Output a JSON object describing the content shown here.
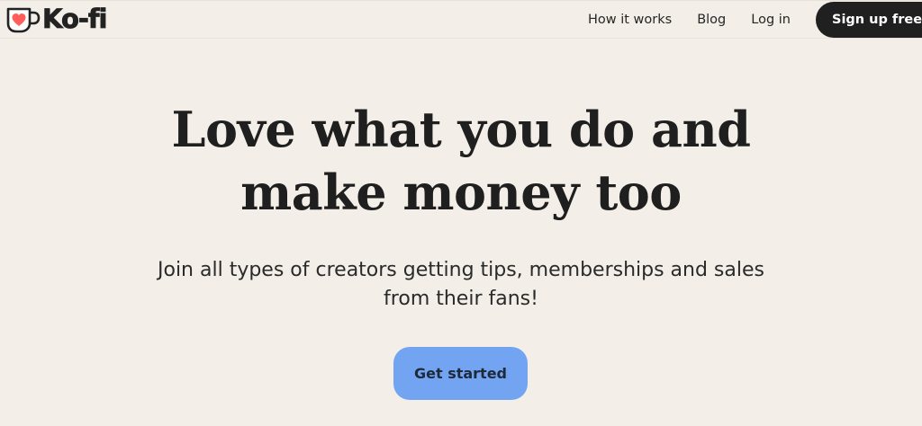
{
  "header": {
    "logo_text": "Ko-fi",
    "logo_icon": "kofi-cup-heart-icon",
    "nav": {
      "how_it_works": "How it works",
      "blog": "Blog",
      "log_in": "Log in",
      "sign_up": "Sign up free"
    }
  },
  "hero": {
    "title_line1": "Love what you do and",
    "title_line2": "make money too",
    "subtitle_line1": "Join all types of creators getting tips, memberships and sales",
    "subtitle_line2": "from their fans!",
    "cta_label": "Get started"
  },
  "colors": {
    "background": "#f3efe8",
    "text": "#202020",
    "cta": "#72a4f2",
    "heart": "#ff5e5b",
    "signup_button": "#202020"
  }
}
